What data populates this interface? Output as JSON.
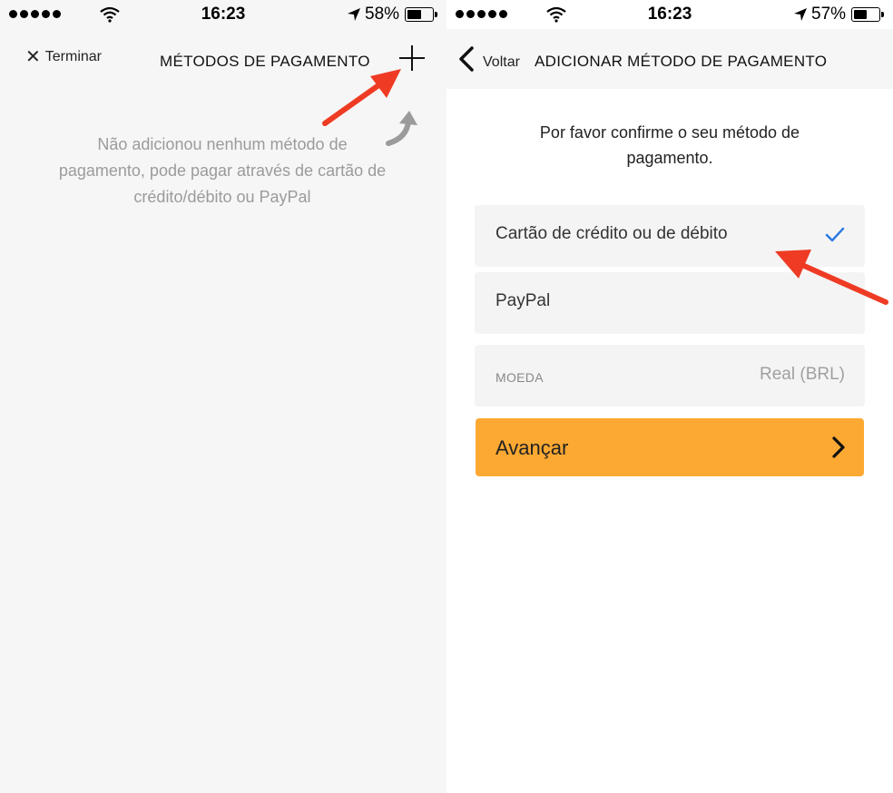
{
  "left": {
    "status": {
      "time": "16:23",
      "battery_pct": "58%",
      "battery_level": 0.58
    },
    "nav": {
      "done_label": "Terminar",
      "title": "MÉTODOS DE PAGAMENTO",
      "add_icon": "plus-icon"
    },
    "empty_message": "Não adicionou nenhum método de pagamento, pode pagar através de cartão de crédito/débito ou PayPal"
  },
  "right": {
    "status": {
      "time": "16:23",
      "battery_pct": "57%",
      "battery_level": 0.57
    },
    "nav": {
      "back_label": "Voltar",
      "title": "ADICIONAR MÉTODO DE PAGAMENTO"
    },
    "confirm_text": "Por favor confirme o seu método de pagamento.",
    "options": {
      "card": {
        "label": "Cartão de crédito ou de débito",
        "selected": true
      },
      "paypal": {
        "label": "PayPal",
        "selected": false
      }
    },
    "currency": {
      "label": "MOEDA",
      "value": "Real (BRL)"
    },
    "advance_label": "Avançar"
  },
  "colors": {
    "accent_button": "#fca933",
    "check": "#2a7ae2",
    "annotation_arrow": "#ef3b24",
    "hint_text": "#9b9b9b"
  }
}
